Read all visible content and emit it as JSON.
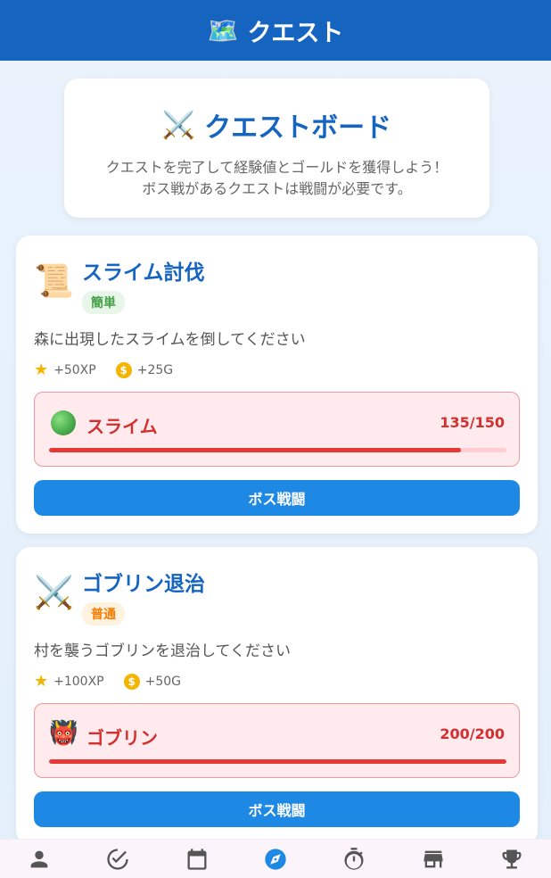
{
  "appbar": {
    "title": "クエスト",
    "icon": "map-icon"
  },
  "header": {
    "icon": "crossed-swords-icon",
    "title": "クエストボード",
    "subtitle_line1": "クエストを完了して経験値とゴールドを獲得しよう！",
    "subtitle_line2": "ボス戦があるクエストは戦闘が必要です。"
  },
  "quests": [
    {
      "icon": "scroll-icon",
      "title": "スライム討伐",
      "difficulty": "簡単",
      "description": "森に出現したスライムを倒してください",
      "xp_reward": "+50XP",
      "gold_reward": "+25G",
      "boss": {
        "icon": "green-circle-icon",
        "name": "スライム",
        "hp_text": "135/150",
        "hp_fraction": 0.9
      },
      "button_label": "ボス戦闘"
    },
    {
      "icon": "crossed-swords-icon",
      "title": "ゴブリン退治",
      "difficulty": "普通",
      "description": "村を襲うゴブリンを退治してください",
      "xp_reward": "+100XP",
      "gold_reward": "+50G",
      "boss": {
        "icon": "ogre-icon",
        "name": "ゴブリン",
        "hp_text": "200/200",
        "hp_fraction": 1.0
      },
      "button_label": "ボス戦闘"
    }
  ],
  "bottom_nav": {
    "items": [
      "person-icon",
      "check-circle-icon",
      "calendar-icon",
      "compass-icon",
      "timer-icon",
      "store-icon",
      "trophy-icon"
    ],
    "active": "compass-icon",
    "active_color": "#1e88e5",
    "inactive_color": "#555555"
  },
  "colors": {
    "appbar": "#1565c0",
    "accent": "#1e88e5",
    "boss_red": "#d32f2f"
  }
}
